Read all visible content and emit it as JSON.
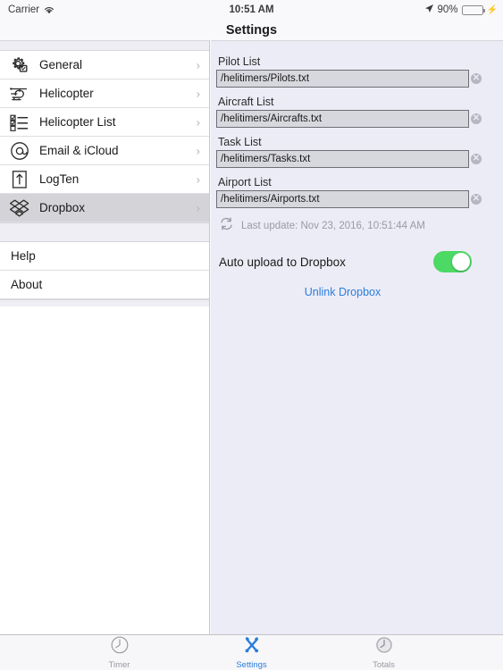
{
  "status_bar": {
    "carrier": "Carrier",
    "wifi_icon": "wifi-icon",
    "time": "10:51 AM",
    "location_icon": "location-arrow-icon",
    "battery_percent": "90%",
    "battery_level": 90,
    "charging_icon": "lightning-bolt-icon"
  },
  "nav": {
    "title": "Settings"
  },
  "sidebar": {
    "items": [
      {
        "label": "General",
        "icon": "gear-icon",
        "chevron": "›",
        "selected": false
      },
      {
        "label": "Helicopter",
        "icon": "helicopter-icon",
        "chevron": "›",
        "selected": false
      },
      {
        "label": "Helicopter List",
        "icon": "checklist-icon",
        "chevron": "›",
        "selected": false
      },
      {
        "label": "Email & iCloud",
        "icon": "at-sign-icon",
        "chevron": "›",
        "selected": false
      },
      {
        "label": "LogTen",
        "icon": "export-upload-icon",
        "chevron": "›",
        "selected": false
      },
      {
        "label": "Dropbox",
        "icon": "dropbox-icon",
        "chevron": "›",
        "selected": true
      }
    ],
    "secondary_items": [
      {
        "label": "Help"
      },
      {
        "label": "About"
      }
    ]
  },
  "detail": {
    "fields": [
      {
        "label": "Pilot List",
        "value": "/helitimers/Pilots.txt",
        "placeholder": "/helitimers/Pilots.txt",
        "clear_icon": "clear-field-icon"
      },
      {
        "label": "Aircraft List",
        "value": "/helitimers/Aircrafts.txt",
        "placeholder": "/helitimers/Aircrafts.txt",
        "clear_icon": "clear-field-icon"
      },
      {
        "label": "Task List",
        "value": "/helitimers/Tasks.txt",
        "placeholder": "/helitimers/Tasks.txt",
        "clear_icon": "clear-field-icon"
      },
      {
        "label": "Airport List",
        "value": "/helitimers/Airports.txt",
        "placeholder": "/helitimers/Airports.txt",
        "clear_icon": "clear-field-icon"
      }
    ],
    "refresh_icon": "refresh-sync-icon",
    "last_update": "Last update: Nov 23, 2016, 10:51:44 AM",
    "auto_upload_label": "Auto upload to Dropbox",
    "auto_upload_on": true,
    "unlink_label": "Unlink Dropbox"
  },
  "tabbar": {
    "tabs": [
      {
        "label": "Timer",
        "icon": "clock-outline-icon",
        "active": false
      },
      {
        "label": "Settings",
        "icon": "tools-icon",
        "active": true
      },
      {
        "label": "Totals",
        "icon": "clock-filled-icon",
        "active": false
      }
    ]
  },
  "colors": {
    "accent_blue": "#2a7ddc",
    "toggle_green": "#4cd964",
    "detail_background": "#ececf7",
    "selected_row": "#d4d4d8"
  }
}
